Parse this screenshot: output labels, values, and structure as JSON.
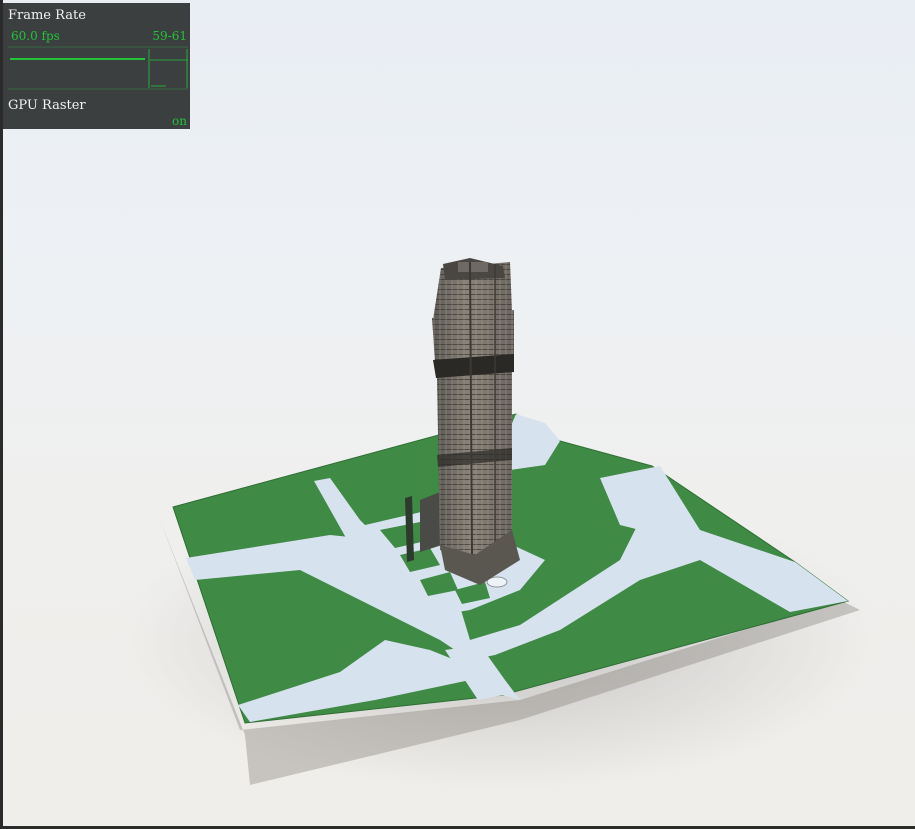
{
  "stats": {
    "frame_rate_title": "Frame Rate",
    "fps_value": "60.0 fps",
    "fps_range": "59-61",
    "gpu_raster_label": "GPU Raster",
    "gpu_raster_value": "on"
  },
  "colors": {
    "panel_bg": "#3c3f40",
    "accent_green": "#22c33a",
    "grass": "#3f8a45",
    "road": "#d6e2ee",
    "tower": "#6e6a63"
  },
  "scene": {
    "subject": "3d-tower-model-on-city-block"
  }
}
